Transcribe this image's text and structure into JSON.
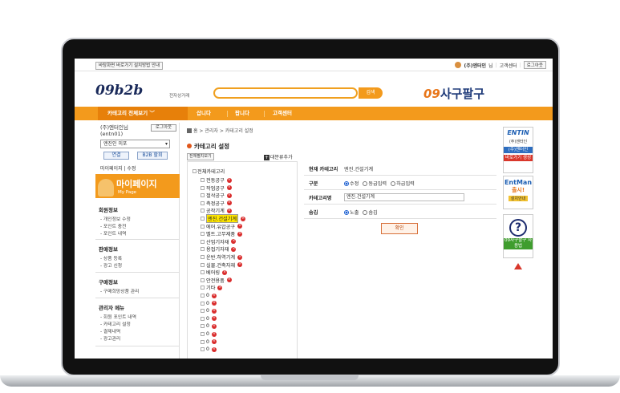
{
  "topbar": {
    "shortcut_hint": "바탕화면 바로가기 설치방법 안내",
    "user_name": "(주)엔터인",
    "user_suffix": "님",
    "customer_center": "고객센터",
    "logout": "로그아웃"
  },
  "header": {
    "logo": "09b2b",
    "logo_sub": "전자상거래",
    "search_button": "검색",
    "search_value": "",
    "brand_num": "09",
    "brand_text": "사구팔구"
  },
  "nav": {
    "category_all": "카테고리 전체보기",
    "items": [
      "삽니다",
      "팝니다",
      "고객센터"
    ]
  },
  "sidebar": {
    "user_line1": "(주)엔터인님",
    "user_line2": "(entn01)",
    "logout": "로그아웃",
    "select_value": "엔진인 미포",
    "btn_connect": "연결",
    "btn_b2b": "B2B 할회",
    "links": "마이페이지 | 수정",
    "mypage_title": "마이페이지",
    "mypage_sub": "My Page",
    "sections": [
      {
        "title": "회원정보",
        "items": [
          "- 개인정보 수정",
          "- 포인트 충전",
          "- 포인트 내역"
        ]
      },
      {
        "title": "판매정보",
        "items": [
          "- 상품 등록",
          "- 광고 신청"
        ]
      },
      {
        "title": "구매정보",
        "items": [
          "- 구매희망상품 관리"
        ]
      },
      {
        "title": "관리자 메뉴",
        "items": [
          "- 회원 포인트 내역",
          "- 카테고리 설정",
          "- 결제내역",
          "- 광고관리"
        ]
      }
    ]
  },
  "main": {
    "breadcrumb": "홈 > 관리자 > 카테고리 설정",
    "title": "카테고리 설정",
    "expand_btn": "전체펼치보기",
    "add_category": "대분류추가",
    "tree_root": "전체카테고리",
    "tree_items": [
      "전동공구",
      "작업공구",
      "절삭공구",
      "측정공구",
      "공작기계",
      "엔진.건설기계",
      "에어.유압공구",
      "벨트.고무제품",
      "산업기자재",
      "용접기자재",
      "운반.하역기계",
      "실물.건축자재",
      "베어링",
      "안전용품",
      "기타",
      "0",
      "0",
      "0",
      "0",
      "0",
      "0",
      "0",
      "0"
    ],
    "selected_index": 5
  },
  "detail": {
    "current_label": "현재 카테고리",
    "current_value": "엔진.건설기계",
    "type_label": "구분",
    "type_options": [
      "수정",
      "동급입력",
      "하급입력"
    ],
    "type_selected": 0,
    "name_label": "카테고리명",
    "name_value": "엔진.건설기계",
    "hide_label": "숨김",
    "hide_options": [
      "노출",
      "숨김"
    ],
    "hide_selected": 0,
    "confirm": "확인"
  },
  "ads": {
    "ad1_logo": "ENTIN",
    "ad1_sub": "(주)엔터인",
    "ad1_bar": "(주)엔터인",
    "ad1_bar2": "바로가기 생성",
    "ad2_logo": "EntMan",
    "ad2_sub": "출시!",
    "ad2_tag": "설치안내",
    "ad3_text": "09사구팔구 사용법"
  },
  "colors": {
    "accent": "#f39a1c",
    "nav_dark": "#e7800a",
    "selected_highlight": "#ffe600",
    "delete_dot": "#d92b2b"
  }
}
